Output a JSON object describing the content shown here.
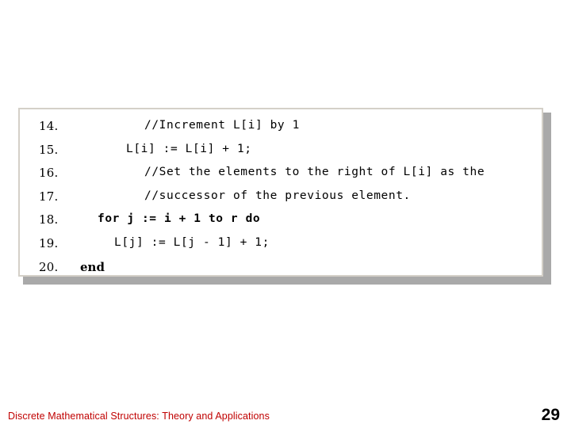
{
  "slide": {
    "code_block": {
      "lines": [
        {
          "number": "14.",
          "text": "//Increment L[i] by 1",
          "style": "mono",
          "indent": "ind-1"
        },
        {
          "number": "15.",
          "text": "L[i] := L[i] + 1;",
          "style": "mono",
          "indent": "ind-2"
        },
        {
          "number": "16.",
          "text": "//Set the elements to the right of L[i] as the",
          "style": "mono",
          "indent": "ind-3"
        },
        {
          "number": "17.",
          "text": "//successor of the previous element.",
          "style": "mono",
          "indent": "ind-4"
        },
        {
          "number": "18.",
          "text": "for j := i + 1 to r do",
          "style": "mono-bold",
          "indent": "ind-5"
        },
        {
          "number": "19.",
          "text": "L[j] := L[j - 1] + 1;",
          "style": "mono",
          "indent": "ind-6"
        },
        {
          "number": "20.",
          "text": "end",
          "style": "serif-bold",
          "indent": "ind-7"
        }
      ]
    },
    "footer": {
      "citation": "Discrete Mathematical Structures: Theory and Applications",
      "page_number": "29"
    },
    "colors": {
      "footer_text": "#c00000",
      "panel_shadow": "#a9a9a9",
      "panel_border": "#d4d0c8"
    }
  }
}
